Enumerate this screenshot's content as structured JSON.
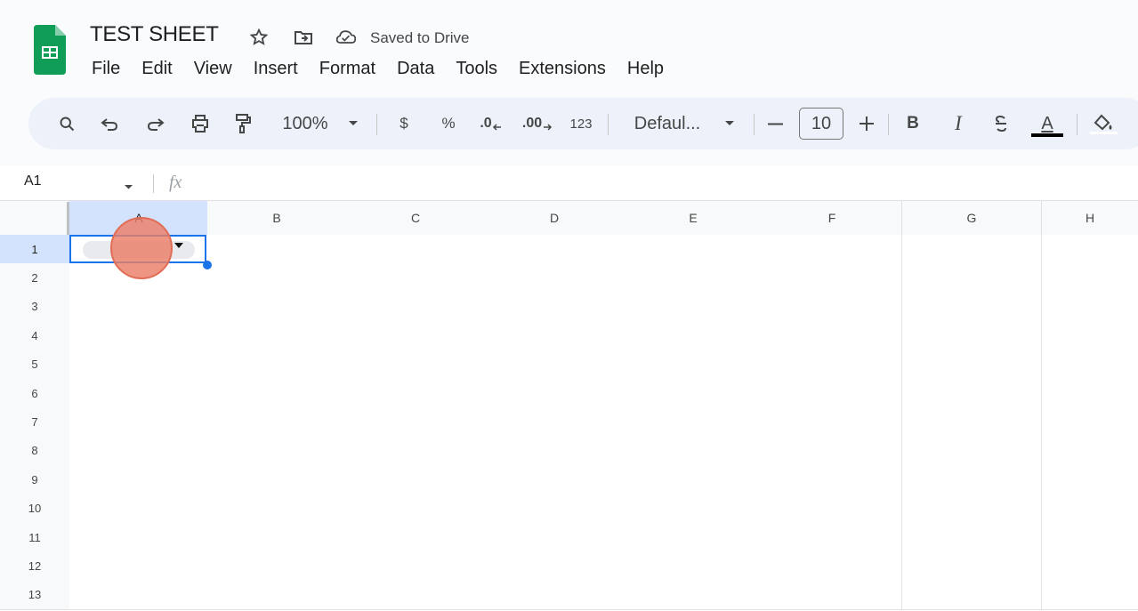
{
  "app": {
    "title": "TEST SHEET",
    "saved_status": "Saved to Drive",
    "logo_icon": "google-sheets-logo",
    "brand_color": "#0f9d58"
  },
  "menu": [
    "File",
    "Edit",
    "View",
    "Insert",
    "Format",
    "Data",
    "Tools",
    "Extensions",
    "Help"
  ],
  "toolbar": {
    "zoom": "100%",
    "currency": "$",
    "percent": "%",
    "decrease_decimal": ".0",
    "increase_decimal": ".00",
    "number_format": "123",
    "font": "Defaul...",
    "font_size": "10",
    "bold": "B",
    "italic": "I",
    "text_color": "A"
  },
  "formula_bar": {
    "name_box": "A1",
    "fx_label": "fx"
  },
  "grid": {
    "columns": [
      "A",
      "B",
      "C",
      "D",
      "E",
      "F",
      "G",
      "H"
    ],
    "rows": [
      "1",
      "2",
      "3",
      "4",
      "5",
      "6",
      "7",
      "8",
      "9",
      "10",
      "11",
      "12",
      "13"
    ],
    "selected_column": "A",
    "selected_row": "1",
    "active_cell": "A1"
  },
  "colors": {
    "accent": "#1a73e8",
    "selection_header": "#d3e3fd",
    "toolbar_background": "#edf2fa",
    "click_indicator": "#eb7e68"
  }
}
